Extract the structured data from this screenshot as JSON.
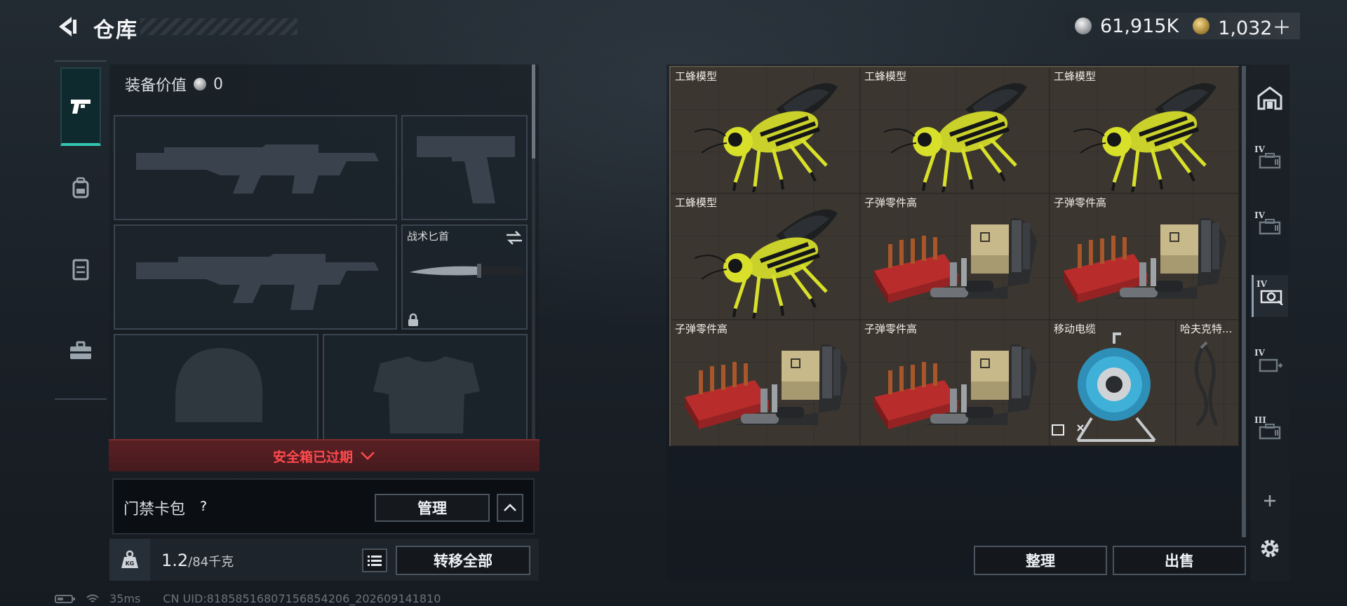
{
  "header": {
    "title": "仓库",
    "currencies": [
      {
        "icon": "silver-coin-icon",
        "value": "61,915K"
      },
      {
        "icon": "gold-coin-icon",
        "value": "1,032＋"
      }
    ]
  },
  "categories": [
    {
      "icon": "pistol-icon",
      "active": true
    },
    {
      "icon": "backpack-icon",
      "active": false
    },
    {
      "icon": "vest-icon",
      "active": false
    },
    {
      "icon": "toolbox-icon",
      "active": false
    }
  ],
  "equipment": {
    "value_label": "装备价值",
    "value": "0",
    "slots": {
      "primary_1": {
        "icon": "rifle-silhouette-icon"
      },
      "pistol": {
        "icon": "pistol-silhouette-icon"
      },
      "primary_2": {
        "icon": "rifle-silhouette-icon"
      },
      "melee": {
        "label": "战术匕首",
        "icon": "knife-icon",
        "swap_icon": "swap-icon",
        "locked": true
      },
      "helmet": {
        "icon": "helmet-silhouette-icon"
      },
      "armor": {
        "icon": "armor-silhouette-icon"
      }
    }
  },
  "safebox": {
    "text": "安全箱已过期",
    "color": "#ff4a4e"
  },
  "access_card": {
    "label": "门禁卡包",
    "help": "?",
    "manage": "管理"
  },
  "weight": {
    "current": "1.2",
    "capacity": "/84千克",
    "transfer_all": "转移全部"
  },
  "status": {
    "ping": "35ms",
    "uid": "CN UID:81858516807156854206_202609141810"
  },
  "storage": {
    "items": [
      {
        "name": "工蜂模型",
        "type": "bee"
      },
      {
        "name": "工蜂模型",
        "type": "bee"
      },
      {
        "name": "工蜂模型",
        "type": "bee"
      },
      {
        "name": "工蜂模型",
        "type": "bee"
      },
      {
        "name": "子弹零件高",
        "type": "ammo"
      },
      {
        "name": "子弹零件高",
        "type": "ammo"
      },
      {
        "name": "子弹零件高",
        "type": "ammo"
      },
      {
        "name": "子弹零件高",
        "type": "ammo"
      },
      {
        "name": "移动电缆",
        "type": "cable"
      },
      {
        "name": "哈夫克特...",
        "type": "cord"
      }
    ],
    "sort": "整理",
    "sell": "出售"
  },
  "containers": [
    {
      "tier": "",
      "icon": "safehouse-icon"
    },
    {
      "tier": "IV",
      "icon": "case-icon"
    },
    {
      "tier": "IV",
      "icon": "case-icon"
    },
    {
      "tier": "IV",
      "icon": "case-gear-icon"
    },
    {
      "tier": "IV",
      "icon": "case-add-icon"
    },
    {
      "tier": "III",
      "icon": "case-icon"
    },
    {
      "tier": "",
      "icon": "add-icon",
      "symbol": "+"
    }
  ],
  "colors": {
    "accent": "#33c6b2",
    "cell_bg": "#3b3630",
    "bee_yellow": "#d8e02a"
  }
}
